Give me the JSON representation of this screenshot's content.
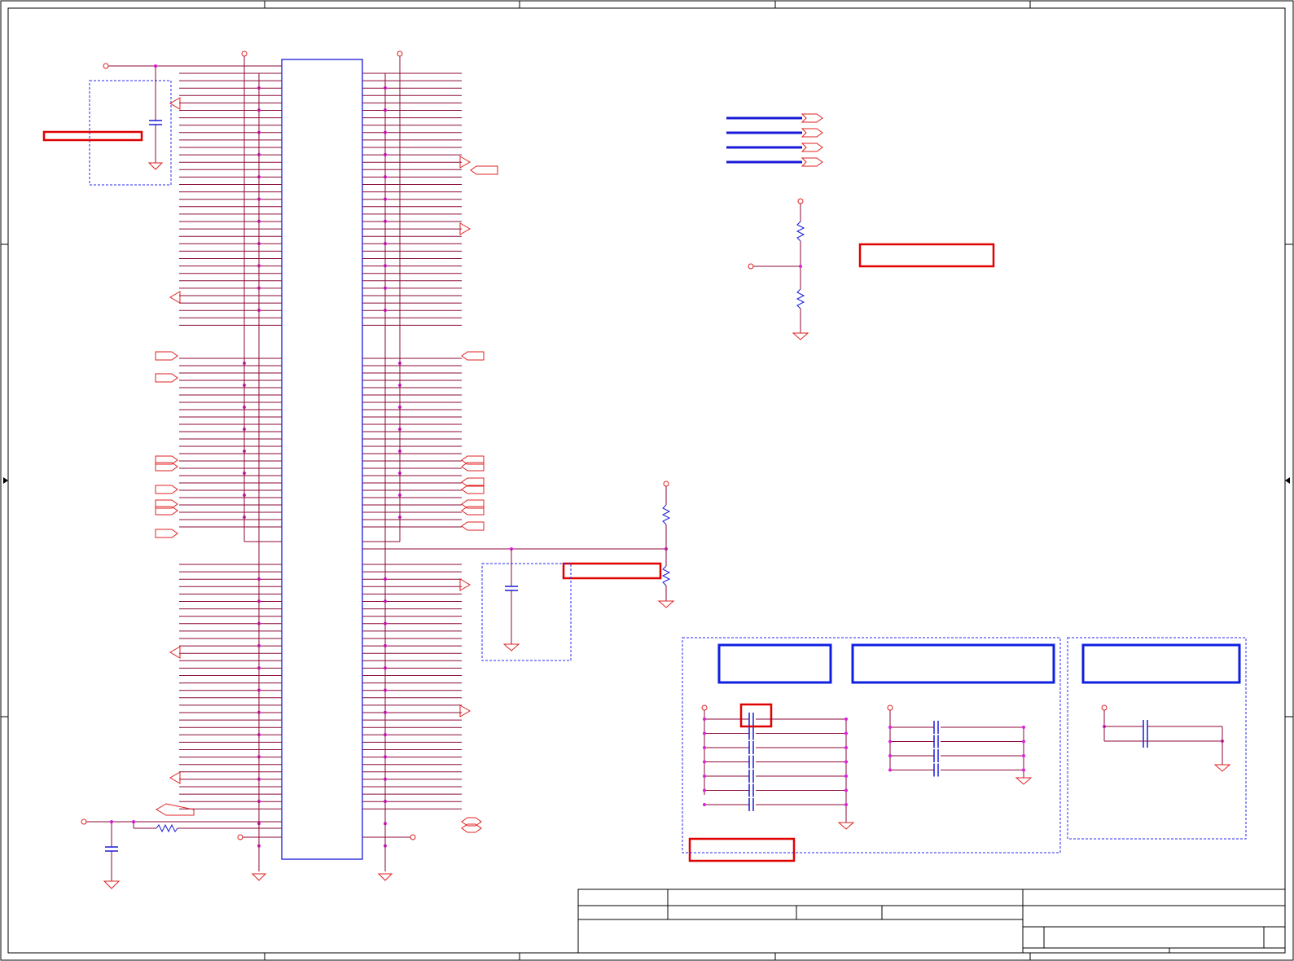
{
  "title_block": {
    "title": "",
    "size": "",
    "document_number": "",
    "rev": "",
    "date": "",
    "sheet": ""
  },
  "colors": {
    "wire": "#8b0a3a",
    "component_red": "#e02020",
    "component_blue": "#1a1ad8",
    "junction": "#e020e0",
    "frame": "#000000",
    "boundary": "#2a2af0",
    "highlight_red": "#e00000",
    "highlight_blue": "#1020e0"
  },
  "components": {
    "main_ic": "ic-package",
    "resistor_divider_top": "resistor-divider",
    "resistor_divider_mid": "resistor-divider",
    "decoupling_groups": [
      "cap-group-left",
      "cap-group-middle",
      "cap-group-right"
    ]
  }
}
